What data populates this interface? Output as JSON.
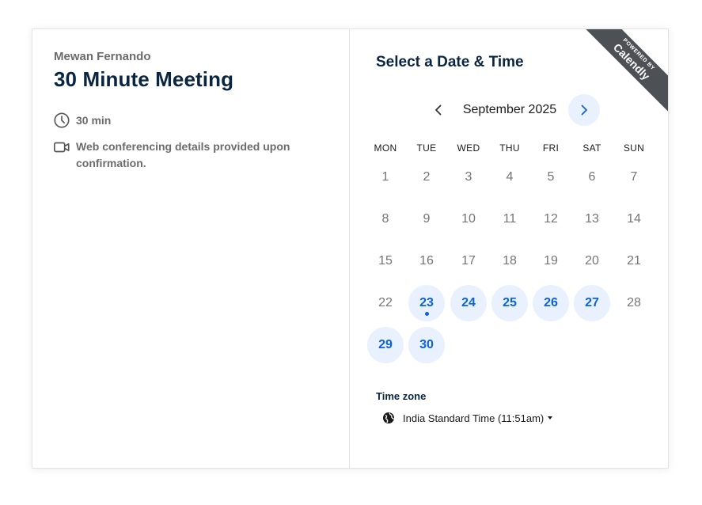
{
  "organizer": "Mewan Fernando",
  "event_title": "30 Minute Meeting",
  "duration": "30 min",
  "conferencing": "Web conferencing details provided upon confirmation.",
  "right_title": "Select a Date & Time",
  "calendar": {
    "month_label": "September 2025",
    "weekdays": [
      "MON",
      "TUE",
      "WED",
      "THU",
      "FRI",
      "SAT",
      "SUN"
    ],
    "weeks": [
      [
        {
          "d": "1"
        },
        {
          "d": "2"
        },
        {
          "d": "3"
        },
        {
          "d": "4"
        },
        {
          "d": "5"
        },
        {
          "d": "6"
        },
        {
          "d": "7"
        }
      ],
      [
        {
          "d": "8"
        },
        {
          "d": "9"
        },
        {
          "d": "10"
        },
        {
          "d": "11"
        },
        {
          "d": "12"
        },
        {
          "d": "13"
        },
        {
          "d": "14"
        }
      ],
      [
        {
          "d": "15"
        },
        {
          "d": "16"
        },
        {
          "d": "17"
        },
        {
          "d": "18"
        },
        {
          "d": "19"
        },
        {
          "d": "20"
        },
        {
          "d": "21"
        }
      ],
      [
        {
          "d": "22"
        },
        {
          "d": "23",
          "available": true,
          "today": true
        },
        {
          "d": "24",
          "available": true
        },
        {
          "d": "25",
          "available": true
        },
        {
          "d": "26",
          "available": true
        },
        {
          "d": "27",
          "available": true
        },
        {
          "d": "28"
        }
      ],
      [
        {
          "d": "29",
          "available": true
        },
        {
          "d": "30",
          "available": true
        }
      ]
    ]
  },
  "timezone": {
    "label": "Time zone",
    "value": "India Standard Time (11:51am)"
  },
  "branding": {
    "powered_by": "POWERED BY",
    "brand": "Calendly"
  },
  "colors": {
    "accent": "#0b63d6",
    "available_bg": "#e8f1fd",
    "title": "#0a2540",
    "ribbon": "#4d5055"
  },
  "icons": {
    "duration": "clock-icon",
    "conferencing": "video-camera-icon",
    "timezone": "globe-icon",
    "prev": "chevron-left-icon",
    "next": "chevron-right-icon"
  }
}
